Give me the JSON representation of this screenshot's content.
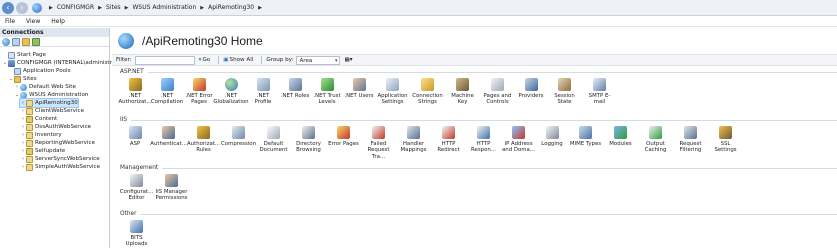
{
  "address": {
    "crumbs": [
      "CONFIGMGR",
      "Sites",
      "WSUS Administration",
      "ApiRemoting30"
    ]
  },
  "menu": [
    "File",
    "View",
    "Help"
  ],
  "connections": {
    "title": "Connections",
    "tree": [
      {
        "label": "Start Page"
      },
      {
        "label": "CONFIGMGR (INTERNAL\\administr"
      },
      {
        "label": "Application Pools"
      },
      {
        "label": "Sites"
      },
      {
        "label": "Default Web Site"
      },
      {
        "label": "WSUS Administration"
      },
      {
        "label": "ApiRemoting30"
      },
      {
        "label": "ClientWebService"
      },
      {
        "label": "Content"
      },
      {
        "label": "DssAuthWebService"
      },
      {
        "label": "Inventory"
      },
      {
        "label": "ReportingWebService"
      },
      {
        "label": "Selfupdate"
      },
      {
        "label": "ServerSyncWebService"
      },
      {
        "label": "SimpleAuthWebService"
      }
    ]
  },
  "main": {
    "title": "/ApiRemoting30 Home",
    "filter": {
      "label": "Filter:",
      "go": "Go",
      "show_all": "Show All",
      "group_by_label": "Group by:",
      "group_by_value": "Area"
    },
    "sections": [
      {
        "title": "ASP.NET",
        "items": [
          ".NET\nAuthorizat...",
          ".NET\nCompilation",
          ".NET Error\nPages",
          ".NET\nGlobalization",
          ".NET Profile",
          ".NET Roles",
          ".NET Trust\nLevels",
          ".NET Users",
          "Application\nSettings",
          "Connection\nStrings",
          "Machine Key",
          "Pages and\nControls",
          "Providers",
          "Session State",
          "SMTP E-mail"
        ]
      },
      {
        "title": "IIS",
        "items": [
          "ASP",
          "Authenticat...",
          "Authorizat...\nRules",
          "Compression",
          "Default\nDocument",
          "Directory\nBrowsing",
          "Error Pages",
          "Failed\nRequest Tra...",
          "Handler\nMappings",
          "HTTP\nRedirect",
          "HTTP\nRespon...",
          "IP Address\nand Doma...",
          "Logging",
          "MIME Types",
          "Modules",
          "Output\nCaching",
          "Request\nFiltering",
          "SSL Settings"
        ]
      },
      {
        "title": "Management",
        "items": [
          "Configurat...\nEditor",
          "IIS Manager\nPermissions"
        ]
      },
      {
        "title": "Other",
        "items": [
          "BITS Uploads"
        ]
      }
    ]
  },
  "colors": {
    "selection": "#cde6ff",
    "accent": "#1d66b8"
  }
}
